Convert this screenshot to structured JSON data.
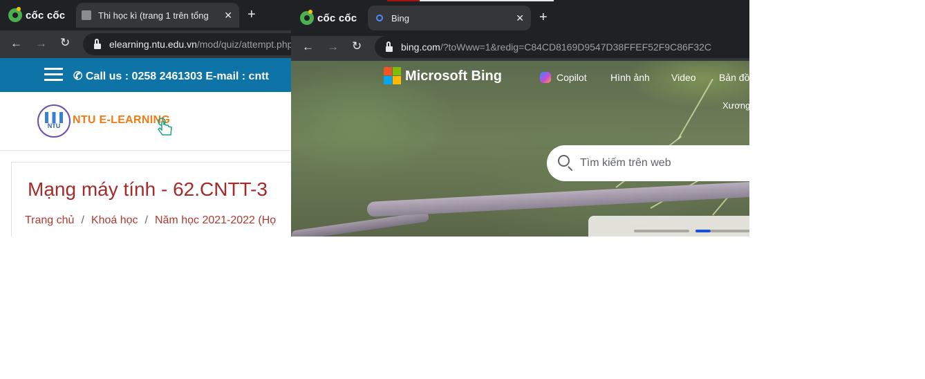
{
  "back_window": {
    "browser_name": "cốc cốc",
    "tab_title": "Thi học kì (trang 1 trên tổng",
    "url_domain": "elearning.ntu.edu.vn",
    "url_path": "/mod/quiz/attempt.php",
    "site": {
      "contact": "Call us : 0258 2461303  E-mail : cntt",
      "logo_text": "NTU E-LEARNING",
      "emblem_text": "NTU",
      "course_title": "Mạng máy tính - 62.CNTT-3",
      "breadcrumb": [
        "Trang chủ",
        "Khoá học",
        "Năm học 2021-2022 (Họ"
      ]
    }
  },
  "front_window": {
    "browser_name": "cốc cốc",
    "tab_title": "Bing",
    "url_domain": "bing.com",
    "url_path": "/?toWww=1&redig=C84CD8169D9547D38FFEF52F9C86F32C",
    "page": {
      "brand": "Microsoft Bing",
      "nav": [
        "Copilot",
        "Hình ảnh",
        "Video",
        "Bản đồ"
      ],
      "sub_nav": "Xương",
      "search_placeholder": "Tìm kiếm trên web"
    }
  },
  "icons": {
    "new_tab": "+",
    "close": "✕",
    "back": "←",
    "forward": "→",
    "reload": "↻"
  },
  "colors": {
    "chrome_dark": "#202124",
    "chrome_bar": "#35363a",
    "ntu_blue": "#0e74a8",
    "course_red": "#a52a2a",
    "ntu_orange": "#f07a13"
  }
}
